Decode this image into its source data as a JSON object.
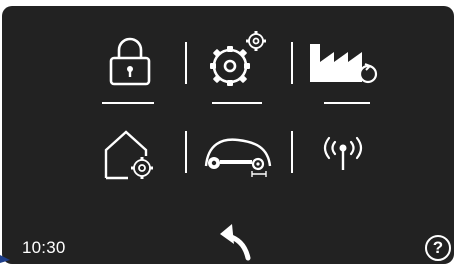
{
  "status": {
    "time": "10:30"
  },
  "menu": {
    "items": [
      {
        "icon": "lock-icon"
      },
      {
        "icon": "gears-icon"
      },
      {
        "icon": "factory-reset-icon"
      },
      {
        "icon": "home-settings-icon"
      },
      {
        "icon": "mower-settings-icon"
      },
      {
        "icon": "wireless-signal-icon"
      }
    ]
  },
  "footer": {
    "help_label": "?",
    "back_icon": "back-arrow-icon"
  },
  "colors": {
    "screen_bg": "#222222",
    "foreground": "#ffffff"
  }
}
